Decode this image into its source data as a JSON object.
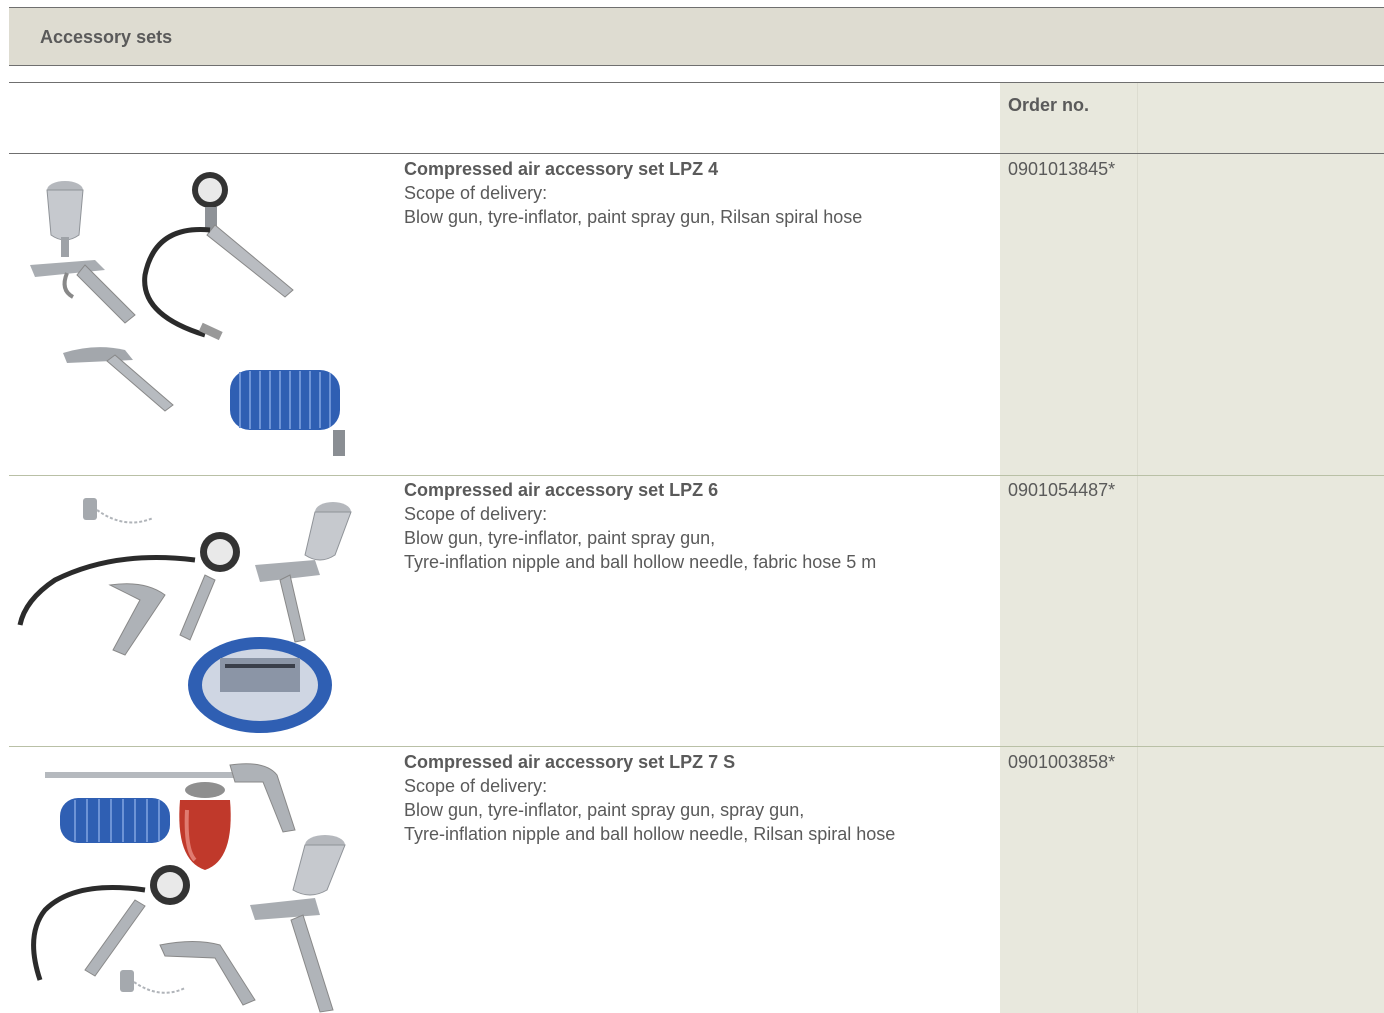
{
  "section": {
    "title": "Accessory sets"
  },
  "table": {
    "order_header": "Order no."
  },
  "products": [
    {
      "title": "Compressed air accessory set LPZ 4",
      "scope_label": "Scope of delivery:",
      "lines": [
        "Blow gun, tyre-inflator, paint spray gun, Rilsan spiral hose"
      ],
      "order_no": "0901013845*"
    },
    {
      "title": "Compressed air accessory set LPZ 6",
      "scope_label": "Scope of delivery:",
      "lines": [
        "Blow gun, tyre-inflator, paint spray gun,",
        "Tyre-inflation nipple and ball hollow needle, fabric hose 5 m"
      ],
      "order_no": "0901054487*"
    },
    {
      "title": "Compressed air accessory set LPZ 7 S",
      "scope_label": "Scope of delivery:",
      "lines": [
        "Blow gun, tyre-inflator, paint spray gun, spray gun,",
        "Tyre-inflation nipple and ball hollow needle, Rilsan spiral hose"
      ],
      "order_no": "0901003858*"
    }
  ],
  "colors": {
    "header_bg": "#dedcd1",
    "order_col_bg": "#e8e8dd",
    "text": "#5a5a5a",
    "hose_blue": "#2f5fb3",
    "red_cup": "#c0392b"
  }
}
